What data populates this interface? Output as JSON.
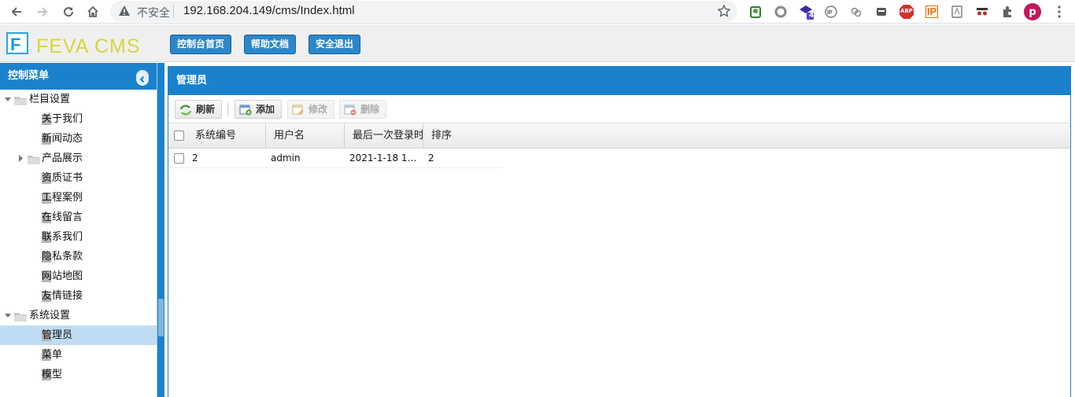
{
  "browser": {
    "insecure_label": "不安全",
    "url": "192.168.204.149/cms/Index.html",
    "ext_badge": "4",
    "profile_initial": "p",
    "abp_label": "ABP",
    "ip_label": "IP"
  },
  "header": {
    "logo_letter": "F",
    "logo_text": "FEVA CMS",
    "buttons": [
      "控制台首页",
      "帮助文档",
      "安全退出"
    ]
  },
  "sidebar": {
    "title": "控制菜单",
    "tree": [
      {
        "label": "栏目设置",
        "type": "folder",
        "expanded": true,
        "depth": 0
      },
      {
        "label": "关于我们",
        "type": "page",
        "depth": 1
      },
      {
        "label": "新闻动态",
        "type": "page",
        "depth": 1
      },
      {
        "label": "产品展示",
        "type": "folder",
        "expanded": false,
        "depth": 1
      },
      {
        "label": "资质证书",
        "type": "page",
        "depth": 1
      },
      {
        "label": "工程案例",
        "type": "page",
        "depth": 1
      },
      {
        "label": "在线留言",
        "type": "page",
        "depth": 1
      },
      {
        "label": "联系我们",
        "type": "page",
        "depth": 1
      },
      {
        "label": "隐私条款",
        "type": "page",
        "depth": 1
      },
      {
        "label": "网站地图",
        "type": "page",
        "depth": 1
      },
      {
        "label": "友情链接",
        "type": "page",
        "depth": 1
      },
      {
        "label": "系统设置",
        "type": "folder",
        "expanded": true,
        "depth": 0
      },
      {
        "label": "管理员",
        "type": "page",
        "depth": 1,
        "selected": true
      },
      {
        "label": "菜单",
        "type": "page",
        "depth": 1
      },
      {
        "label": "模型",
        "type": "page",
        "depth": 1
      }
    ]
  },
  "main": {
    "title": "管理员",
    "toolbar": {
      "refresh": "刷新",
      "add": "添加",
      "edit": "修改",
      "delete": "删除"
    },
    "grid": {
      "columns": [
        "系统编号",
        "用户名",
        "最后一次登录时间",
        "排序"
      ],
      "rows": [
        [
          "2",
          "admin",
          "2021-1-18 1…",
          "2"
        ]
      ]
    }
  },
  "colors": {
    "accent": "#1a82cc",
    "button": "#2c87c9",
    "logo": "#d6d63a",
    "selected_row": "#bfdcf2"
  }
}
